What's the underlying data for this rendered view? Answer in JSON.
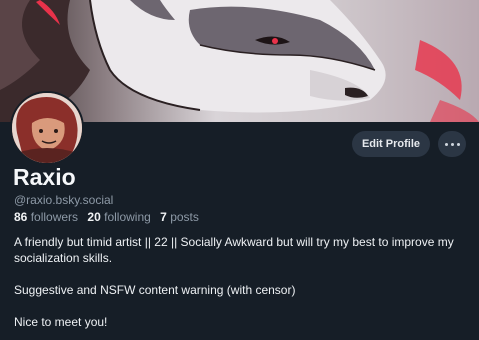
{
  "profile": {
    "display_name": "Raxio",
    "handle": "@raxio.bsky.social",
    "followers_count": "86",
    "followers_label": "followers",
    "following_count": "20",
    "following_label": "following",
    "posts_count": "7",
    "posts_label": "posts",
    "bio_lines": [
      "A friendly but timid artist || 22 || Socially Awkward but will try my best to improve my socialization skills.",
      "Suggestive and NSFW content warning (with censor)",
      "Nice to meet you!"
    ]
  },
  "actions": {
    "edit_label": "Edit Profile",
    "more_icon": "ellipsis-icon"
  },
  "colors": {
    "background": "#161e27",
    "button_bg": "#2b3644",
    "muted_text": "#8d99a6",
    "accent_red": "#e8324a"
  }
}
